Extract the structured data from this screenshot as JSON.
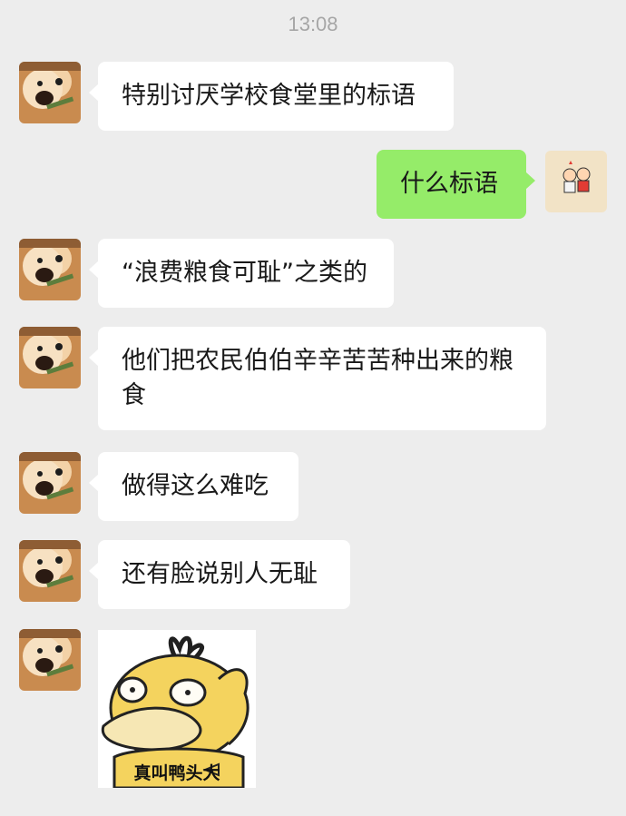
{
  "chat": {
    "timestamp": "13:08",
    "messages": [
      {
        "side": "left",
        "text": "特别讨厌学校食堂里的标语"
      },
      {
        "side": "right",
        "text": "什么标语"
      },
      {
        "side": "left",
        "text": "“浪费粮食可耻”之类的"
      },
      {
        "side": "left",
        "text": "他们把农民伯伯辛辛苦苦种出来的粮食"
      },
      {
        "side": "left",
        "text": "做得这么难吃"
      },
      {
        "side": "left",
        "text": "还有脸说别人无耻"
      }
    ],
    "sticker": {
      "caption": "真叫鸭头大"
    }
  },
  "colors": {
    "background": "#ededed",
    "incoming_bubble": "#ffffff",
    "outgoing_bubble": "#95ec69",
    "timestamp": "#a6a6a6"
  },
  "icons": {
    "left_avatar": "dog-avatar-icon",
    "right_avatar": "cartoon-avatar-icon",
    "sticker": "psyduck-sticker-icon"
  }
}
